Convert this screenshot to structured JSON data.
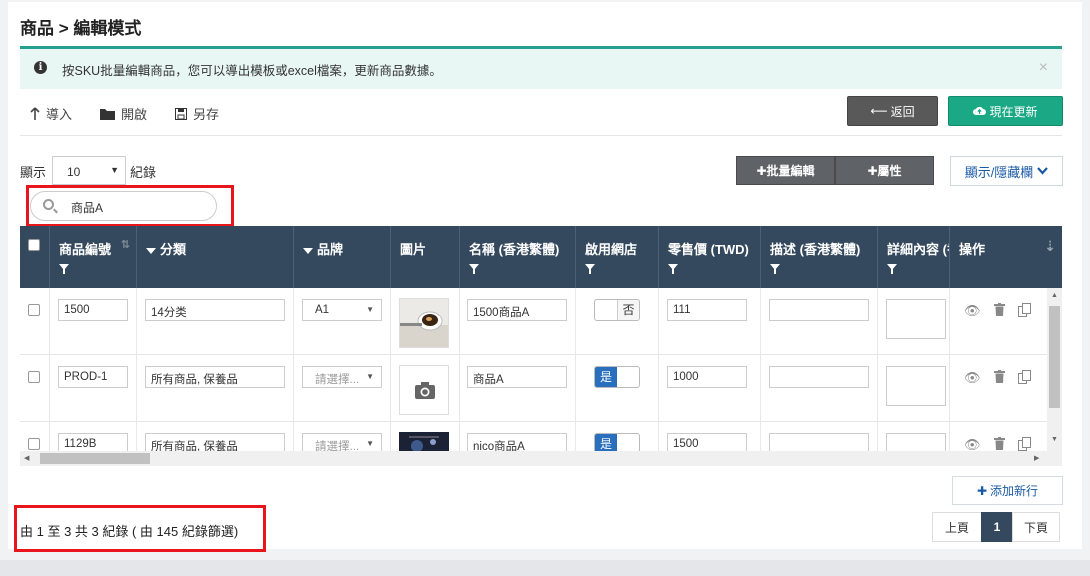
{
  "page": {
    "title": "商品 > 編輯模式"
  },
  "alert": {
    "message": "按SKU批量編輯商品，您可以導出模板或excel檔案，更新商品數據。",
    "close": "×"
  },
  "toolbar": {
    "import": "導入",
    "open": "開啟",
    "save_as": "另存",
    "back": "返回",
    "update_now": "現在更新"
  },
  "list_controls": {
    "show_label": "顯示",
    "length_value": "10",
    "records_label": "紀錄",
    "bulk_edit": "批量編輯",
    "attributes": "屬性",
    "show_hide_columns": "顯示/隱藏欄",
    "search_value": "商品A"
  },
  "columns": {
    "sku": "商品編號",
    "category": "分類",
    "brand": "品牌",
    "image": "圖片",
    "name": "名稱 (香港繁體)",
    "enabled": "啟用網店",
    "price": "零售價 (TWD)",
    "description": "描述 (香港繁體)",
    "details": "詳細內容 (香港",
    "actions": "操作"
  },
  "rows": [
    {
      "sku": "1500",
      "category": "14分类",
      "brand": "A1",
      "name": "1500商品A",
      "enabled": "否",
      "price": "111"
    },
    {
      "sku": "PROD-1",
      "category": "所有商品, 保養品",
      "brand": "請選擇...",
      "name": "商品A",
      "enabled": "是",
      "price": "1000"
    },
    {
      "sku": "1129B",
      "category": "所有商品, 保養品",
      "brand": "請選擇...",
      "name": "nico商品A",
      "enabled": "是",
      "price": "1500"
    }
  ],
  "footer": {
    "add_row": "添加新行",
    "info": "由 1 至 3 共 3 紀錄 ( 由 145 紀錄篩選)",
    "prev": "上頁",
    "page": "1",
    "next": "下頁"
  },
  "colors": {
    "header_bg": "#34495e",
    "accent_green": "#1aa885",
    "highlight_red": "#e8161c",
    "toggle_blue": "#2a6fbd"
  }
}
